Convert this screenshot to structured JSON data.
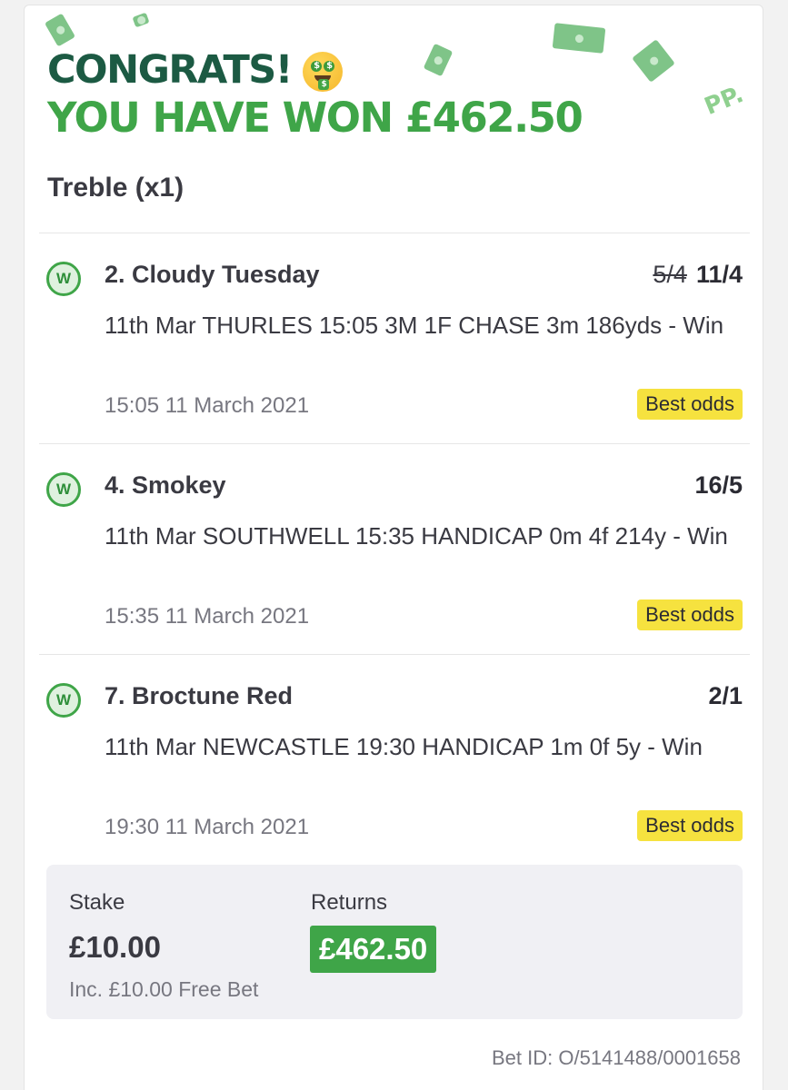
{
  "header": {
    "congrats": "CONGRATS!",
    "won_text": "YOU HAVE WON £462.50",
    "bet_type": "Treble (x1)",
    "brand_mark": "PP."
  },
  "selections": [
    {
      "badge": "W",
      "name": "2. Cloudy Tuesday",
      "old_odds": "5/4",
      "odds": "11/4",
      "description": "11th Mar THURLES 15:05 3M 1F CHASE 3m 186yds - Win",
      "time": "15:05 11 March 2021",
      "tag": "Best odds"
    },
    {
      "badge": "W",
      "name": "4. Smokey",
      "old_odds": "",
      "odds": "16/5",
      "description": "11th Mar SOUTHWELL 15:35 HANDICAP 0m 4f 214y - Win",
      "time": "15:35 11 March 2021",
      "tag": "Best odds"
    },
    {
      "badge": "W",
      "name": "7. Broctune Red",
      "old_odds": "",
      "odds": "2/1",
      "description": "11th Mar NEWCASTLE 19:30 HANDICAP 1m 0f 5y - Win",
      "time": "19:30 11 March 2021",
      "tag": "Best odds"
    }
  ],
  "summary": {
    "stake_label": "Stake",
    "stake_value": "£10.00",
    "stake_note": "Inc. £10.00 Free Bet",
    "returns_label": "Returns",
    "returns_value": "£462.50"
  },
  "bet_id": "Bet ID: O/5141488/0001658",
  "colors": {
    "dark_green": "#1c5a43",
    "brand_green": "#3fa548",
    "best_odds_yellow": "#f6e23f"
  },
  "icons": {
    "emoji": "money-mouth-face-icon",
    "decor": "banknote-icon",
    "badge": "win-badge-icon"
  }
}
